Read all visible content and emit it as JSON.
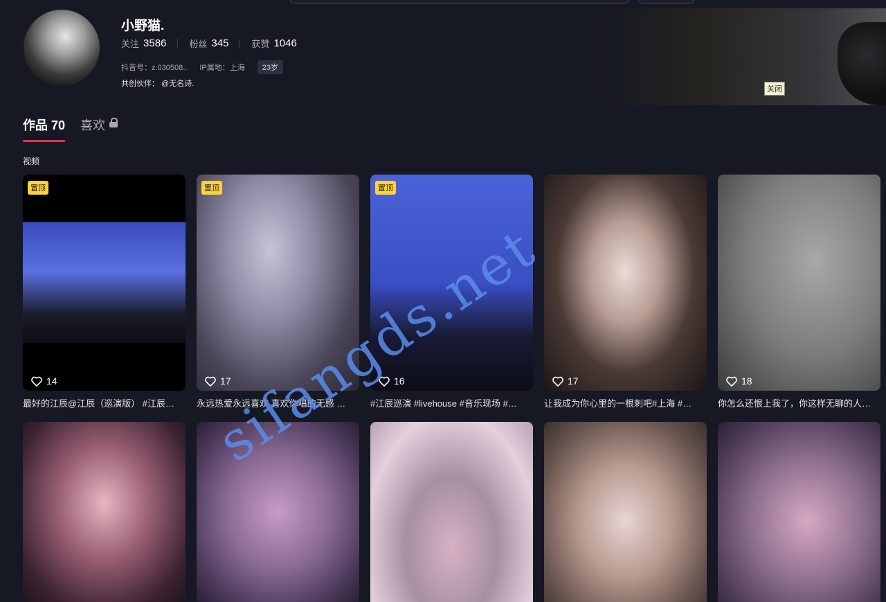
{
  "profile": {
    "name": "小野猫.",
    "stats": [
      {
        "label": "关注",
        "value": "3586"
      },
      {
        "label": "粉丝",
        "value": "345"
      },
      {
        "label": "获赞",
        "value": "1046"
      }
    ],
    "douyin_id": "抖音号：z.030508..",
    "ip_location": "IP属地：上海",
    "age": "23岁",
    "partner": "共创伙伴： @无名诗."
  },
  "banner": {
    "close_tooltip": "关闭"
  },
  "tabs": [
    {
      "label": "作品 70"
    },
    {
      "label": "喜欢"
    }
  ],
  "section_label": "视频",
  "videos": [
    {
      "pinned": "置顶",
      "likes": "14",
      "caption": "最好的江辰@江辰（巡演版） #江辰…"
    },
    {
      "pinned": "置顶",
      "likes": "17",
      "caption": "永远热爱永远喜欢 喜欢你唱的无感 …"
    },
    {
      "pinned": "置顶",
      "likes": "16",
      "caption": "#江辰巡演 #livehouse #音乐现场 #…"
    },
    {
      "pinned": "",
      "likes": "17",
      "caption": "让我成为你心里的一根刺吧#上海 #…"
    },
    {
      "pinned": "",
      "likes": "18",
      "caption": "你怎么还恨上我了，你这样无聊的人…"
    },
    {
      "pinned": "",
      "likes": "",
      "caption": ""
    },
    {
      "pinned": "",
      "likes": "",
      "caption": ""
    },
    {
      "pinned": "",
      "likes": "",
      "caption": ""
    },
    {
      "pinned": "",
      "likes": "",
      "caption": ""
    },
    {
      "pinned": "",
      "likes": "",
      "caption": ""
    }
  ],
  "watermark": "sifangds.net",
  "colors": {
    "background": "#161823",
    "accent": "#fe2c55",
    "pin_badge": "#fdd23d"
  }
}
